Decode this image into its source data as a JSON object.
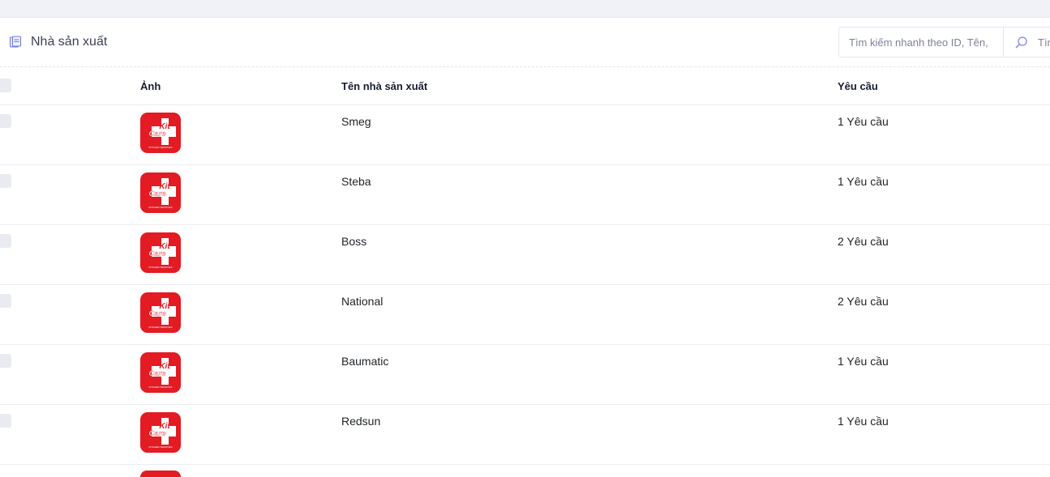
{
  "header": {
    "title": "Nhà sản xuất",
    "search_placeholder": "Tìm kiếm nhanh theo ID, Tên,",
    "search_button_label": "Tìm"
  },
  "table": {
    "columns": {
      "image": "Ảnh",
      "name": "Tên nhà sản xuất",
      "requests": "Yêu cầu"
    },
    "rows": [
      {
        "name": "Smeg",
        "requests": "1 Yêu cầu"
      },
      {
        "name": "Steba",
        "requests": "1 Yêu cầu"
      },
      {
        "name": "Boss",
        "requests": "2 Yêu cầu"
      },
      {
        "name": "National",
        "requests": "2 Yêu cầu"
      },
      {
        "name": "Baumatic",
        "requests": "1 Yêu cầu"
      },
      {
        "name": "Redsun",
        "requests": "1 Yêu cầu"
      }
    ]
  },
  "logo": {
    "text_top": "Kit",
    "text_bottom": "Care",
    "tagline": "KITCHEN SERVICES",
    "color": "#e31b23"
  },
  "icons": {
    "header": "document-icon",
    "search": "search-icon"
  }
}
